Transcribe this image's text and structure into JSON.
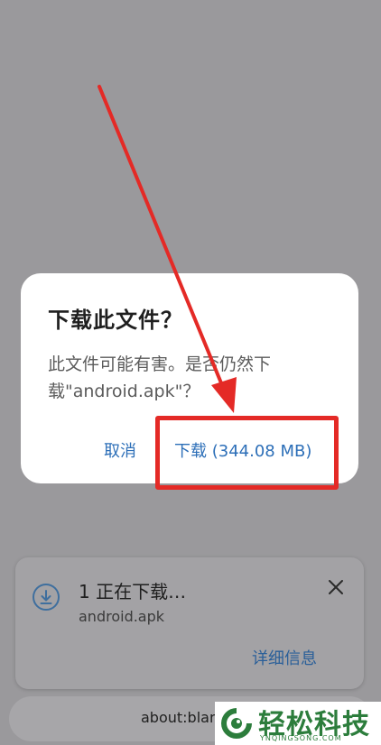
{
  "dialog": {
    "title": "下载此文件？",
    "message": "此文件可能有害。是否仍然下载\"android.apk\"？",
    "cancel_label": "取消",
    "download_label": "下载 (344.08 MB)"
  },
  "notification": {
    "title": "1 正在下载…",
    "filename": "android.apk",
    "details_label": "详细信息",
    "download_icon": "download-icon",
    "close_icon": "close-icon"
  },
  "address_bar": {
    "url": "about:blank"
  },
  "watermark": {
    "text": "轻松科技",
    "domain": "YNQINGSONG.COM"
  },
  "colors": {
    "accent": "#2d6fb8",
    "highlight": "#e42a26",
    "watermark": "#2c7d3c"
  }
}
